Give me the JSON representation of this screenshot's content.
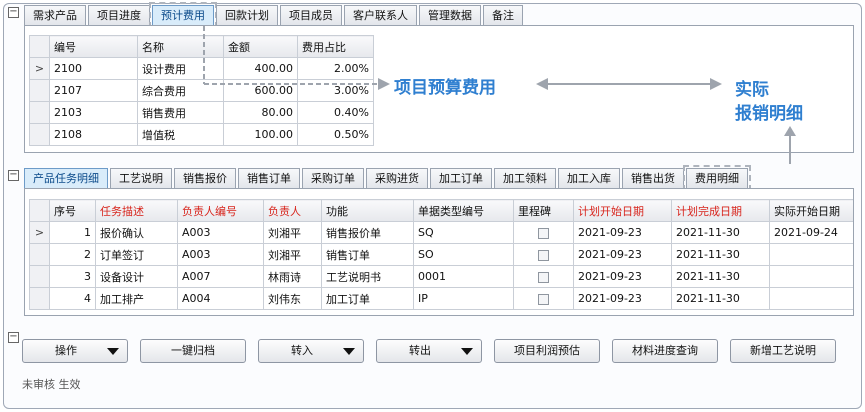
{
  "top_tabs": [
    {
      "label": "需求产品"
    },
    {
      "label": "项目进度"
    },
    {
      "label": "预计费用"
    },
    {
      "label": "回款计划"
    },
    {
      "label": "项目成员"
    },
    {
      "label": "客户联系人"
    },
    {
      "label": "管理数据"
    },
    {
      "label": "备注"
    }
  ],
  "cost_table": {
    "columns": [
      "编号",
      "名称",
      "金额",
      "费用占比"
    ],
    "rows": [
      {
        "code": "2100",
        "name": "设计费用",
        "amount": "400.00",
        "ratio": "2.00%"
      },
      {
        "code": "2107",
        "name": "综合费用",
        "amount": "600.00",
        "ratio": "3.00%"
      },
      {
        "code": "2103",
        "name": "销售费用",
        "amount": "80.00",
        "ratio": "0.40%"
      },
      {
        "code": "2108",
        "name": "增值税",
        "amount": "100.00",
        "ratio": "0.50%"
      }
    ],
    "current_row_marker": ">"
  },
  "annotations": {
    "budget": "项目预算费用",
    "actual_line1": "实际",
    "actual_line2": "报销明细"
  },
  "bottom_tabs": [
    {
      "label": "产品任务明细"
    },
    {
      "label": "工艺说明"
    },
    {
      "label": "销售报价"
    },
    {
      "label": "销售订单"
    },
    {
      "label": "采购订单"
    },
    {
      "label": "采购进货"
    },
    {
      "label": "加工订单"
    },
    {
      "label": "加工领料"
    },
    {
      "label": "加工入库"
    },
    {
      "label": "销售出货"
    },
    {
      "label": "费用明细"
    }
  ],
  "task_table": {
    "columns": [
      "序号",
      "任务描述",
      "负责人编号",
      "负责人",
      "功能",
      "单据类型编号",
      "里程碑",
      "计划开始日期",
      "计划完成日期",
      "实际开始日期"
    ],
    "rows": [
      {
        "no": "1",
        "desc": "报价确认",
        "owner_code": "A003",
        "owner": "刘湘平",
        "func": "销售报价单",
        "doc_type": "SQ",
        "plan_start": "2021-09-23",
        "plan_end": "2021-11-30",
        "actual_start": "2021-09-24"
      },
      {
        "no": "2",
        "desc": "订单签订",
        "owner_code": "A003",
        "owner": "刘湘平",
        "func": "销售订单",
        "doc_type": "SO",
        "plan_start": "2021-09-23",
        "plan_end": "2021-11-30",
        "actual_start": ""
      },
      {
        "no": "3",
        "desc": "设备设计",
        "owner_code": "A007",
        "owner": "林雨诗",
        "func": "工艺说明书",
        "doc_type": "0001",
        "plan_start": "2021-09-23",
        "plan_end": "2021-11-30",
        "actual_start": ""
      },
      {
        "no": "4",
        "desc": "加工排产",
        "owner_code": "A004",
        "owner": "刘伟东",
        "func": "加工订单",
        "doc_type": "IP",
        "plan_start": "2021-09-23",
        "plan_end": "2021-11-30",
        "actual_start": ""
      }
    ],
    "current_row_marker": ">"
  },
  "buttons": {
    "operate": "操作",
    "archive": "一键归档",
    "transfer_in": "转入",
    "transfer_out": "转出",
    "profit_forecast": "项目利润预估",
    "material_progress": "材料进度查询",
    "add_process": "新增工艺说明"
  },
  "status": "未审核 生效",
  "colors": {
    "annotation": "#2f7fd0",
    "required_header": "#d8261e",
    "active_tab": "#d9ecfa"
  }
}
